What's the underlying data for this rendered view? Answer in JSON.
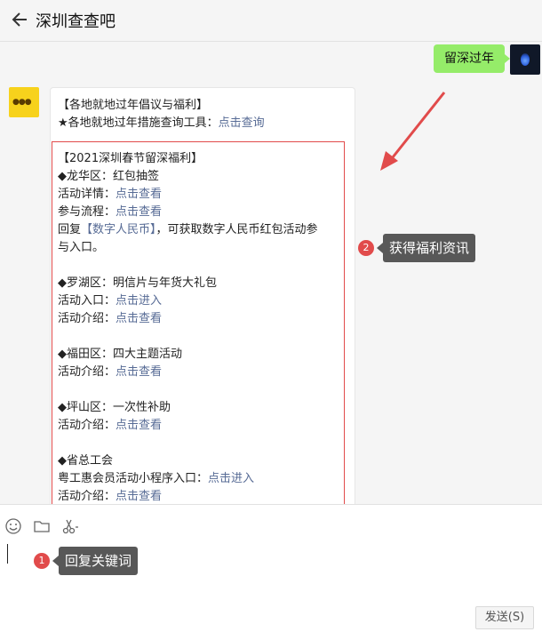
{
  "header": {
    "title": "深圳查查吧"
  },
  "messages": {
    "sent": {
      "text": "留深过年"
    },
    "received": {
      "intro_title": "【各地就地过年倡议与福利】",
      "intro_tool_prefix": "★各地就地过年措施查询工具：",
      "intro_tool_link": "点击查询",
      "section_title": "【2021深圳春节留深福利】",
      "longhua_title": "◆龙华区：红包抽签",
      "longhua_detail_prefix": "活动详情：",
      "longhua_detail_link": "点击查看",
      "longhua_flow_prefix": "参与流程：",
      "longhua_flow_link": "点击查看",
      "reply_prefix": "回复",
      "reply_keyword": "【数字人民币】",
      "reply_suffix": "，可获取数字人民币红包活动参",
      "reply_suffix2": "与入口。",
      "luohu_title": "◆罗湖区：明信片与年货大礼包",
      "luohu_entry_prefix": "活动入口：",
      "luohu_entry_link": "点击进入",
      "luohu_intro_prefix": "活动介绍：",
      "luohu_intro_link": "点击查看",
      "futian_title": "◆福田区：四大主题活动",
      "futian_intro_prefix": "活动介绍：",
      "futian_intro_link": "点击查看",
      "pingshan_title": "◆坪山区：一次性补助",
      "pingshan_intro_prefix": "活动介绍：",
      "pingshan_intro_link": "点击查看",
      "union_title": "◆省总工会",
      "union_entry_prefix": "粤工惠会员活动小程序入口：",
      "union_entry_link": "点击进入",
      "union_intro_prefix": "活动介绍：",
      "union_intro_link": "点击查看"
    }
  },
  "annotations": {
    "badge1": "1",
    "tip1": "回复关键词",
    "badge2": "2",
    "tip2": "获得福利资讯"
  },
  "toolbar": {
    "send_label": "发送(S)"
  },
  "icons": [
    "back-arrow-icon",
    "emoji-icon",
    "folder-icon",
    "scissors-icon"
  ],
  "colors": {
    "accent_green": "#95ec69",
    "link_blue": "#576b95",
    "annotation_red": "#e14b4b"
  }
}
